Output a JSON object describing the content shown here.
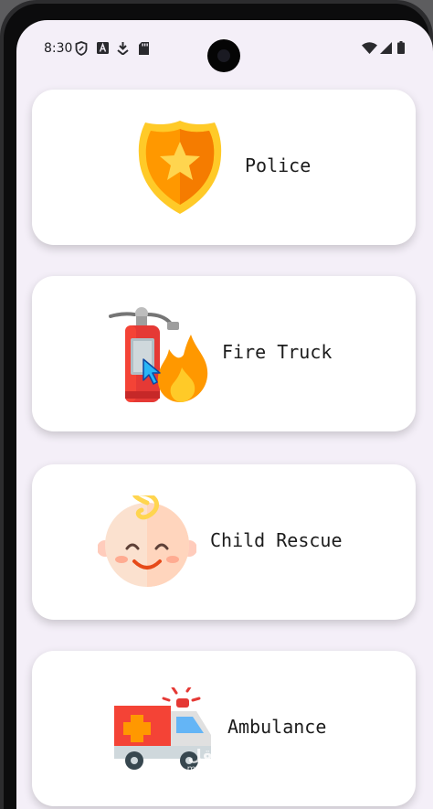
{
  "status_bar": {
    "time": "8:30",
    "left_icons": [
      "shield-icon",
      "a-box-icon",
      "download-icon",
      "sd-card-icon"
    ],
    "right_icons": [
      "wifi-icon",
      "signal-icon",
      "battery-icon"
    ]
  },
  "cards": [
    {
      "label": "Police",
      "icon": "police-badge-icon"
    },
    {
      "label": "Fire Truck",
      "icon": "fire-extinguisher-icon"
    },
    {
      "label": "Child Rescue",
      "icon": "baby-face-icon"
    },
    {
      "label": "Ambulance",
      "icon": "ambulance-icon"
    }
  ],
  "watermark": {
    "arabic": "مستقل",
    "latin": "mostaql.com"
  },
  "colors": {
    "screen_bg": "#f4eff8",
    "card_bg": "#ffffff",
    "text": "#1c1c1c"
  }
}
